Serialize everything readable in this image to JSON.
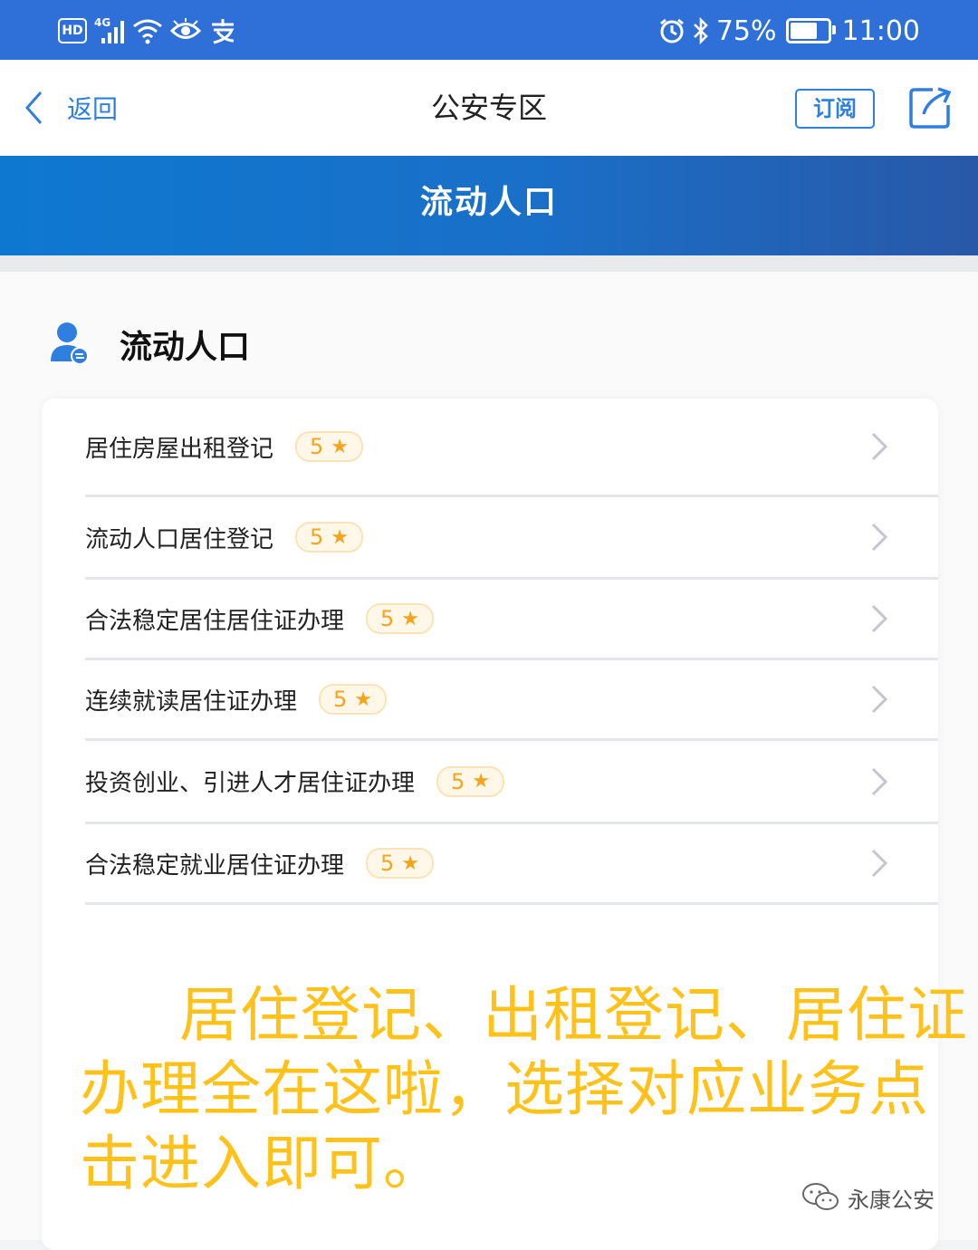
{
  "status_bar": {
    "hd": "HD",
    "network": "4G",
    "battery_text": "75%",
    "battery_level": 75,
    "time": "11:00"
  },
  "nav": {
    "back_label": "返回",
    "title": "公安专区",
    "subscribe_label": "订阅"
  },
  "banner": {
    "title": "流动人口"
  },
  "section": {
    "title": "流动人口"
  },
  "services": [
    {
      "label": "居住房屋出租登记",
      "rating": "5"
    },
    {
      "label": "流动人口居住登记",
      "rating": "5"
    },
    {
      "label": "合法稳定居住居住证办理",
      "rating": "5"
    },
    {
      "label": "连续就读居住证办理",
      "rating": "5"
    },
    {
      "label": "投资创业、引进人才居住证办理",
      "rating": "5"
    },
    {
      "label": "合法稳定就业居住证办理",
      "rating": "5"
    }
  ],
  "caption": {
    "text": "居住登记、出租登记、居住证办理全在这啦，选择对应业务点击进入即可。"
  },
  "watermark": {
    "text": "永康公安"
  },
  "colors": {
    "status_bar": "#2f6fd8",
    "accent": "#2f7fe0",
    "rating": "#f4a51f",
    "caption": "#ffc21a"
  }
}
